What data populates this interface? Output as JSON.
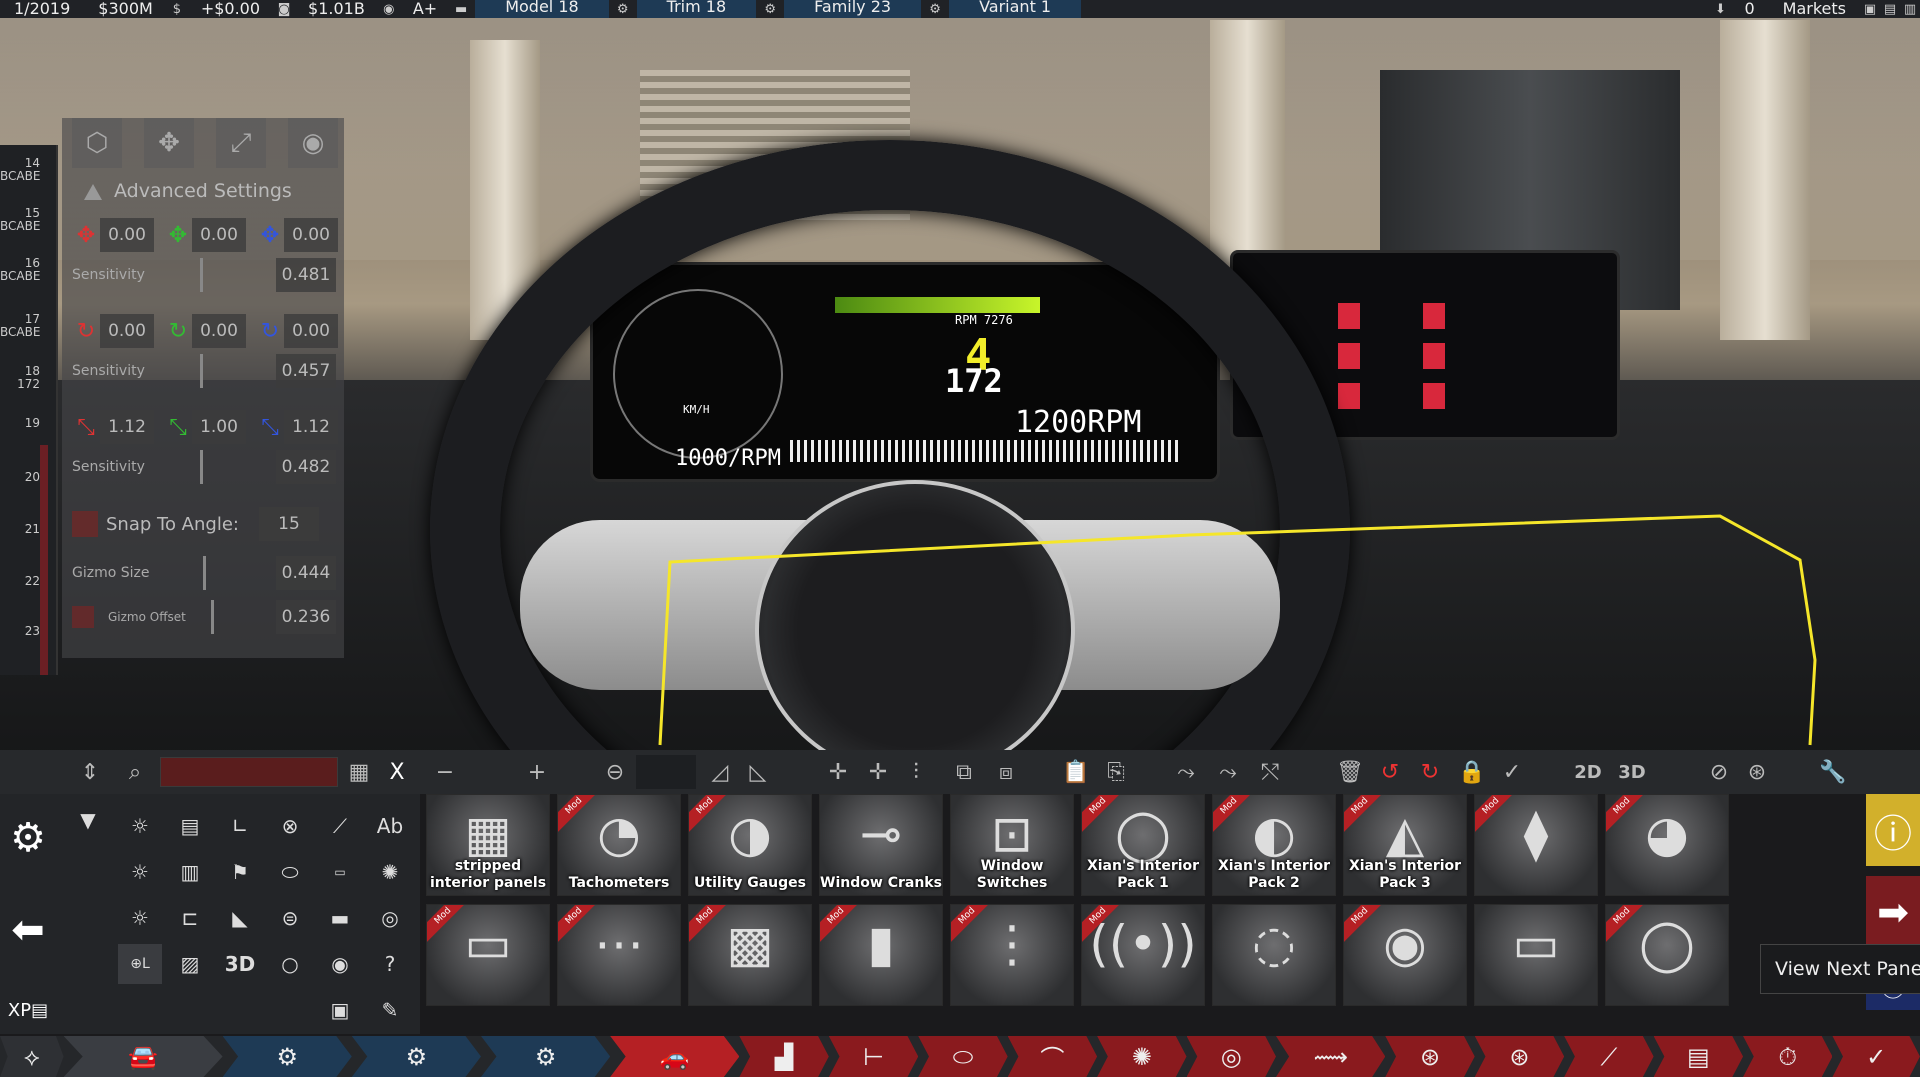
{
  "topbar": {
    "date": "1/2019",
    "funds": "$300M",
    "currency_icon": "dollar-icon",
    "delta": "+$0.00",
    "value": "$1.01B",
    "rating": "A+",
    "model": "Model 18",
    "trim": "Trim 18",
    "family": "Family 23",
    "variant": "Variant 1",
    "zero_count": "0",
    "markets": "Markets"
  },
  "leftrail": {
    "rows": [
      {
        "num": "14",
        "code": "BCABE"
      },
      {
        "num": "15",
        "code": "BCABE"
      },
      {
        "num": "16",
        "code": "BCABE"
      },
      {
        "num": "17",
        "code": "BCABE"
      },
      {
        "num": "18",
        "code": "172"
      },
      {
        "num": "19",
        "code": ""
      },
      {
        "num": "20",
        "code": ""
      },
      {
        "num": "21",
        "code": ""
      },
      {
        "num": "22",
        "code": ""
      },
      {
        "num": "23",
        "code": ""
      }
    ]
  },
  "gizmo": {
    "title": "Advanced Settings",
    "position": {
      "x": "0.00",
      "y": "0.00",
      "z": "0.00",
      "sensitivity_label": "Sensitivity",
      "sensitivity": "0.481"
    },
    "rotation": {
      "x": "0.00",
      "y": "0.00",
      "z": "0.00",
      "sensitivity_label": "Sensitivity",
      "sensitivity": "0.457"
    },
    "scale": {
      "x": "1.12",
      "y": "1.00",
      "z": "1.12",
      "sensitivity_label": "Sensitivity",
      "sensitivity": "0.482"
    },
    "snap_label": "Snap To Angle:",
    "snap_value": "15",
    "gizmo_size_label": "Gizmo Size",
    "gizmo_size": "0.444",
    "gizmo_offset_label": "Gizmo Offset",
    "gizmo_offset": "0.236"
  },
  "cluster": {
    "gear": "4",
    "speed": "172",
    "rpm_big": "1200RPM",
    "rpm_small": "1000/RPM",
    "rpm_top": "RPM 7276",
    "speed_unit": "KM/H"
  },
  "toolbar": {
    "search_value": "",
    "close": "X",
    "mode_2d": "2D",
    "mode_3d": "3D"
  },
  "tools": {
    "label_ab": "Ab",
    "label_3d": "3D",
    "label_help": "?"
  },
  "assets": {
    "row1": [
      {
        "label": "stripped interior panels",
        "mod": false
      },
      {
        "label": "Tachometers",
        "mod": true
      },
      {
        "label": "Utility Gauges",
        "mod": true
      },
      {
        "label": "Window Cranks",
        "mod": false
      },
      {
        "label": "Window Switches",
        "mod": false
      },
      {
        "label": "Xian's Interior Pack 1",
        "mod": true
      },
      {
        "label": "Xian's Interior Pack 2",
        "mod": true
      },
      {
        "label": "Xian's Interior Pack 3",
        "mod": true
      },
      {
        "label": "",
        "mod": true
      },
      {
        "label": "",
        "mod": true
      }
    ],
    "row2": [
      {
        "label": "",
        "mod": true
      },
      {
        "label": "",
        "mod": true
      },
      {
        "label": "",
        "mod": true
      },
      {
        "label": "",
        "mod": true
      },
      {
        "label": "",
        "mod": true
      },
      {
        "label": "",
        "mod": true
      },
      {
        "label": "",
        "mod": false
      },
      {
        "label": "",
        "mod": true
      },
      {
        "label": "",
        "mod": false
      },
      {
        "label": "",
        "mod": true
      }
    ],
    "mod_tag": "Mod"
  },
  "tooltip": "View Next Pane",
  "colors": {
    "accent_red": "#b52024",
    "accent_blue": "#1e3a55",
    "gizmo_x": "#d33",
    "gizmo_y": "#3b3",
    "gizmo_z": "#35d",
    "highlight_yellow": "#f5e62a"
  }
}
